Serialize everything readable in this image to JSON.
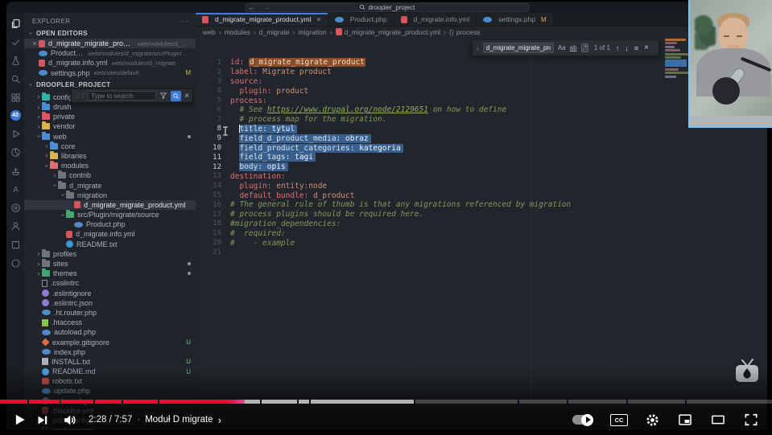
{
  "icons": {
    "close": "×",
    "more": "···",
    "back": "←",
    "forward": "→",
    "up_arrow": "↑",
    "down_arrow": "↓",
    "find_in_selection": "≡",
    "chevron": "›",
    "grip": "⋮⋮",
    "cc": "CC",
    "template_braces": "{}",
    "dot_sep": "·"
  },
  "titlebar": {
    "search_value": "droopler_project"
  },
  "activity_bar": {
    "badge": "43",
    "icons": [
      "files",
      "check",
      "beaker",
      "search",
      "grid",
      "badge",
      "play",
      "pie",
      "ship",
      "letter-a",
      "target",
      "person",
      "box",
      "circle"
    ]
  },
  "explorer": {
    "title": "EXPLORER",
    "open_editors_label": "OPEN EDITORS",
    "project_label": "DROOPLER_PROJECT",
    "search_widget": {
      "placeholder": "Type to search"
    },
    "open_editors": [
      {
        "file": "d_migrate_migrate_product.yml",
        "path": "web/modules/d_migra...",
        "icon": "yml",
        "active": true
      },
      {
        "file": "Product.php",
        "path": "web/modules/d_migrate/src/Plugin/migrate/...",
        "icon": "php"
      },
      {
        "file": "d_migrate.info.yml",
        "path": "web/modules/d_migrate",
        "icon": "yml"
      },
      {
        "file": "settings.php",
        "path": "web/sites/default",
        "icon": "php",
        "marker": "M"
      }
    ],
    "tree": [
      {
        "label": "config",
        "depth": 1,
        "icon": "folder-teal",
        "arrow": ">"
      },
      {
        "label": "drush",
        "depth": 1,
        "icon": "folder-blue",
        "arrow": ">"
      },
      {
        "label": "private",
        "depth": 1,
        "icon": "folder-red",
        "arrow": ">"
      },
      {
        "label": "vendor",
        "depth": 1,
        "icon": "folder-yellow",
        "arrow": ">"
      },
      {
        "label": "web",
        "depth": 1,
        "icon": "folder-blue",
        "arrow": "v",
        "marker": "dot"
      },
      {
        "label": "core",
        "depth": 2,
        "icon": "folder-blue",
        "arrow": ">"
      },
      {
        "label": "libraries",
        "depth": 2,
        "icon": "folder-yellow",
        "arrow": ">"
      },
      {
        "label": "modules",
        "depth": 2,
        "icon": "folder-rose",
        "arrow": "v"
      },
      {
        "label": "contrib",
        "depth": 3,
        "icon": "folder-gray",
        "arrow": ">"
      },
      {
        "label": "d_migrate",
        "depth": 3,
        "icon": "folder-gray",
        "arrow": "v"
      },
      {
        "label": "migration",
        "depth": 4,
        "icon": "folder-gray",
        "arrow": "v"
      },
      {
        "label": "d_migrate_migrate_product.yml",
        "depth": 5,
        "icon": "yml",
        "selected": true
      },
      {
        "label": "src/Plugin/migrate/source",
        "depth": 4,
        "icon": "folder-green",
        "arrow": "v"
      },
      {
        "label": "Product.php",
        "depth": 5,
        "icon": "php"
      },
      {
        "label": "d_migrate.info.yml",
        "depth": 4,
        "icon": "yml"
      },
      {
        "label": "README.txt",
        "depth": 4,
        "icon": "info"
      },
      {
        "label": "profiles",
        "depth": 1,
        "icon": "folder-gray",
        "arrow": ">"
      },
      {
        "label": "sites",
        "depth": 1,
        "icon": "folder-gray",
        "arrow": ">",
        "marker": "dot"
      },
      {
        "label": "themes",
        "depth": 1,
        "icon": "folder-green",
        "arrow": ">",
        "marker": "dot"
      },
      {
        "label": ".csslintrc",
        "depth": 1,
        "icon": "file"
      },
      {
        "label": ".eslintignore",
        "depth": 1,
        "icon": "eslint"
      },
      {
        "label": ".eslintrc.json",
        "depth": 1,
        "icon": "eslint"
      },
      {
        "label": ".ht.router.php",
        "depth": 1,
        "icon": "php"
      },
      {
        "label": ".htaccess",
        "depth": 1,
        "icon": "htaccess"
      },
      {
        "label": "autoload.php",
        "depth": 1,
        "icon": "php"
      },
      {
        "label": "example.gitignore",
        "depth": 1,
        "icon": "git",
        "marker": "U"
      },
      {
        "label": "index.php",
        "depth": 1,
        "icon": "php"
      },
      {
        "label": "INSTALL.txt",
        "depth": 1,
        "icon": "txt",
        "marker": "U"
      },
      {
        "label": "README.md",
        "depth": 1,
        "icon": "md",
        "marker": "U"
      },
      {
        "label": "robots.txt",
        "depth": 1,
        "icon": "robot"
      },
      {
        "label": "update.php",
        "depth": 1,
        "icon": "php"
      },
      {
        "label": "web.config",
        "depth": 1,
        "icon": "gearfile"
      },
      {
        "label": ".blackfire.yml",
        "depth": 1,
        "icon": "yml"
      },
      {
        "label": ".editorconfig",
        "depth": 1,
        "icon": "file"
      },
      {
        "label": ".environment",
        "depth": 1,
        "icon": "file"
      }
    ]
  },
  "tabs": [
    {
      "label": "d_migrate_migrate_product.yml",
      "icon": "yml",
      "active": true,
      "closable": true
    },
    {
      "label": "Product.php",
      "icon": "php"
    },
    {
      "label": "d_migrate.info.yml",
      "icon": "yml"
    },
    {
      "label": "settings.php",
      "icon": "php",
      "marker": "M"
    }
  ],
  "breadcrumb": [
    {
      "label": "web"
    },
    {
      "label": "modules"
    },
    {
      "label": "d_migrate"
    },
    {
      "label": "migration"
    },
    {
      "label": "d_migrate_migrate_product.yml",
      "icon": "yml"
    },
    {
      "label": "process",
      "icon": "braces"
    }
  ],
  "find_widget": {
    "query": "d_migrate_migrate_proc",
    "case_label": "Aa",
    "word_label": "ab",
    "regex_label": ".*",
    "matches": "1 of 1"
  },
  "editor": {
    "language": "yaml",
    "lines": [
      {
        "n": 1,
        "indent": "",
        "seg": [
          [
            "k",
            "id:"
          ],
          [
            "p",
            " "
          ],
          [
            "h",
            "d_migrate_migrate_product"
          ]
        ]
      },
      {
        "n": 2,
        "indent": "",
        "seg": [
          [
            "k",
            "label:"
          ],
          [
            "p",
            " "
          ],
          [
            "v",
            "Migrate product"
          ]
        ]
      },
      {
        "n": 3,
        "indent": "",
        "seg": [
          [
            "k",
            "source:"
          ]
        ]
      },
      {
        "n": 4,
        "indent": "  ",
        "seg": [
          [
            "k",
            "plugin:"
          ],
          [
            "p",
            " "
          ],
          [
            "v",
            "product"
          ]
        ]
      },
      {
        "n": 5,
        "indent": "",
        "seg": [
          [
            "k",
            "process:"
          ]
        ]
      },
      {
        "n": 6,
        "indent": "  ",
        "seg": [
          [
            "c",
            "# See "
          ],
          [
            "l",
            "https://www.drupal.org/node/2129651"
          ],
          [
            "c",
            " on how to define"
          ]
        ]
      },
      {
        "n": 7,
        "indent": "  ",
        "seg": [
          [
            "c",
            "# process map for the migration."
          ]
        ]
      },
      {
        "n": 8,
        "indent": "  ",
        "sel": true,
        "cursor": true,
        "seg": [
          [
            "k",
            "title:"
          ],
          [
            "p",
            " "
          ],
          [
            "v",
            "tytul"
          ]
        ]
      },
      {
        "n": 9,
        "indent": "  ",
        "sel": true,
        "seg": [
          [
            "k",
            "field_d_product_media:"
          ],
          [
            "p",
            " "
          ],
          [
            "v",
            "obraz"
          ]
        ]
      },
      {
        "n": 10,
        "indent": "  ",
        "sel": true,
        "seg": [
          [
            "k",
            "field_product_categories:"
          ],
          [
            "p",
            " "
          ],
          [
            "v",
            "kategoria"
          ]
        ]
      },
      {
        "n": 11,
        "indent": "  ",
        "sel": true,
        "seg": [
          [
            "k",
            "field_tags:"
          ],
          [
            "p",
            " "
          ],
          [
            "v",
            "tagi"
          ]
        ]
      },
      {
        "n": 12,
        "indent": "  ",
        "sel": true,
        "seg": [
          [
            "k",
            "body:"
          ],
          [
            "p",
            " "
          ],
          [
            "v",
            "opis"
          ]
        ]
      },
      {
        "n": 13,
        "indent": "",
        "seg": [
          [
            "k",
            "destination:"
          ]
        ]
      },
      {
        "n": 14,
        "indent": "  ",
        "seg": [
          [
            "k",
            "plugin:"
          ],
          [
            "p",
            " "
          ],
          [
            "v",
            "entity:node"
          ]
        ]
      },
      {
        "n": 15,
        "indent": "  ",
        "seg": [
          [
            "k",
            "default_bundle:"
          ],
          [
            "p",
            " "
          ],
          [
            "v",
            "d_product"
          ]
        ]
      },
      {
        "n": 16,
        "indent": "",
        "seg": [
          [
            "c",
            "# The general rule of thumb is that any migrations referenced by migration"
          ]
        ]
      },
      {
        "n": 17,
        "indent": "",
        "seg": [
          [
            "c",
            "# process plugins should be required here."
          ]
        ]
      },
      {
        "n": 18,
        "indent": "",
        "seg": [
          [
            "c",
            "#migration_dependencies:"
          ]
        ]
      },
      {
        "n": 19,
        "indent": "",
        "seg": [
          [
            "c",
            "#  required:"
          ]
        ]
      },
      {
        "n": 20,
        "indent": "",
        "seg": [
          [
            "c",
            "#    - example"
          ]
        ]
      },
      {
        "n": 21,
        "indent": "",
        "seg": []
      }
    ]
  },
  "player": {
    "time": "2:28 / 7:57",
    "chapter": "Moduł D migrate",
    "played_fraction": 0.315,
    "buffered_fraction": 0.534,
    "chapter_boundaries": [
      0,
      0.036,
      0.077,
      0.12,
      0.155,
      0.202,
      0.336,
      0.383,
      0.397,
      0.534,
      0.67,
      0.733,
      0.81,
      0.886,
      1
    ],
    "colors": {
      "played": "#ff0033",
      "played_edge": "#ff3d9e",
      "buffered": "rgba(255,255,255,0.6)",
      "rest": "rgba(255,255,255,0.22)"
    }
  }
}
